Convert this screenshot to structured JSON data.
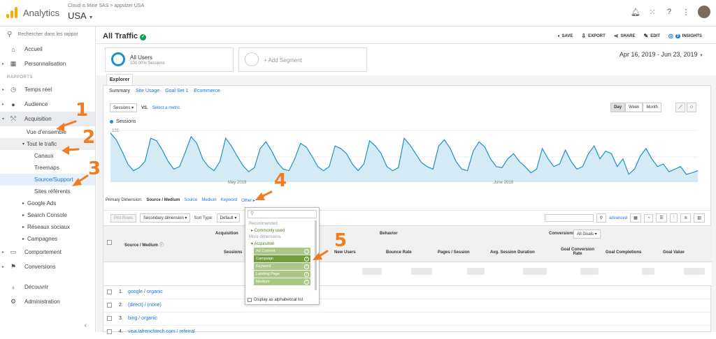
{
  "app": {
    "name": "Analytics",
    "breadcrumb": "Cloud is Mine SAS > appvizer USA",
    "account": "USA"
  },
  "sidebar": {
    "search_placeholder": "Rechercher dans les rappor",
    "section_label": "RAPPORTS",
    "items_top": [
      {
        "label": "Accueil",
        "icon": "home-icon"
      },
      {
        "label": "Personnalisation",
        "icon": "dashboard-icon"
      }
    ],
    "items_reports": [
      {
        "label": "Temps réel",
        "icon": "clock-icon"
      },
      {
        "label": "Audience",
        "icon": "person-icon"
      },
      {
        "label": "Acquisition",
        "icon": "acquisition-icon"
      }
    ],
    "acq_sub": {
      "overview": "Vue d'ensemble",
      "all_traffic": "Tout le trafic",
      "channels": "Canaux",
      "treemaps": "Treemaps",
      "source_medium": "Source/Support",
      "referrals": "Sites référents"
    },
    "acq_groups": [
      "Google Ads",
      "Search Console",
      "Réseaux sociaux",
      "Campagnes"
    ],
    "items_bottom": [
      {
        "label": "Comportement",
        "icon": "behavior-icon"
      },
      {
        "label": "Conversions",
        "icon": "flag-icon"
      }
    ],
    "footer": [
      {
        "label": "Découvrir",
        "icon": "bulb-icon"
      },
      {
        "label": "Administration",
        "icon": "gear-icon"
      }
    ]
  },
  "header": {
    "title": "All Traffic",
    "actions": [
      "SAVE",
      "EXPORT",
      "SHARE",
      "EDIT",
      "INSIGHTS"
    ],
    "insights_badge": "3"
  },
  "segments": {
    "active": "All Users",
    "active_sub": "100.00% Sessions",
    "add": "+ Add Segment"
  },
  "date_range": "Apr 16, 2019 - Jun 23, 2019",
  "explorer": {
    "tab": "Explorer",
    "subtabs": [
      "Summary",
      "Site Usage",
      "Goal Set 1",
      "Ecommerce"
    ]
  },
  "metric": {
    "selected": "Sessions",
    "vs": "VS.",
    "select_link": "Select a metric",
    "granularity": [
      "Day",
      "Week",
      "Month"
    ],
    "active_granularity": "Day"
  },
  "chart_data": {
    "type": "line",
    "series": [
      {
        "name": "Sessions",
        "values": [
          95,
          82,
          60,
          35,
          22,
          28,
          40,
          85,
          80,
          62,
          40,
          25,
          30,
          58,
          88,
          75,
          45,
          30,
          22,
          40,
          85,
          70,
          50,
          32,
          20,
          28,
          65,
          78,
          60,
          38,
          25,
          22,
          45,
          75,
          68,
          50,
          30,
          22,
          30,
          70,
          65,
          55,
          35,
          22,
          35,
          80,
          70,
          55,
          30,
          22,
          28,
          85,
          72,
          55,
          38,
          30,
          25,
          70,
          82,
          65,
          40,
          25,
          22,
          60,
          78,
          68,
          45,
          30,
          28,
          45,
          55,
          40,
          30,
          18,
          25,
          65,
          45,
          30,
          35,
          62,
          40,
          25,
          30,
          55,
          70,
          45,
          60,
          55,
          30,
          45,
          15,
          25,
          50,
          65,
          45,
          30,
          35,
          20,
          25,
          30,
          15,
          18,
          22
        ]
      }
    ],
    "y_ticks": [
      "100",
      "50"
    ],
    "x_ticks": [
      "May 2019",
      "June 2019"
    ],
    "ylim": [
      0,
      100
    ]
  },
  "dimension": {
    "label": "Primary Dimension:",
    "current": "Source / Medium",
    "options": [
      "Source",
      "Medium",
      "Keyword"
    ],
    "other": "Other"
  },
  "toolbar": {
    "plot_rows": "Plot Rows",
    "secondary": "Secondary dimension",
    "sort_label": "Sort Type:",
    "sort_value": "Default",
    "advanced": "advanced"
  },
  "table": {
    "dim_header": "Source / Medium",
    "groups": [
      "Acquisition",
      "Behavior",
      "Conversions"
    ],
    "goal_select": "All Goals",
    "columns": [
      "Sessions",
      "New Users",
      "Bounce Rate",
      "Pages / Session",
      "Avg. Session Duration",
      "Goal Conversion Rate",
      "Goal Completions",
      "Goal Value"
    ],
    "rows": [
      {
        "num": "1.",
        "label": "google / organic"
      },
      {
        "num": "2.",
        "label": "(direct) / (none)"
      },
      {
        "num": "3.",
        "label": "bing / organic"
      },
      {
        "num": "4.",
        "label": "visa.lafrenchtech.com / referral"
      }
    ]
  },
  "dropdown": {
    "recommended": "Recommended",
    "rec_items": [
      "Commonly used"
    ],
    "more": "More dimensions",
    "acq": "Acquisition",
    "chips": [
      "Ad Content",
      "Campaign",
      "Keyword",
      "Landing Page",
      "Medium"
    ],
    "highlighted": "Campaign",
    "alpha": "Display as alphabetical list"
  },
  "annotations": [
    "1",
    "2",
    "3",
    "4",
    "5"
  ],
  "colors": {
    "accent": "#1a73e8",
    "annotation": "#f07c24",
    "chart_line": "#1e90c8",
    "chip": "#a9c886",
    "chip_active": "#6f9e3f"
  }
}
